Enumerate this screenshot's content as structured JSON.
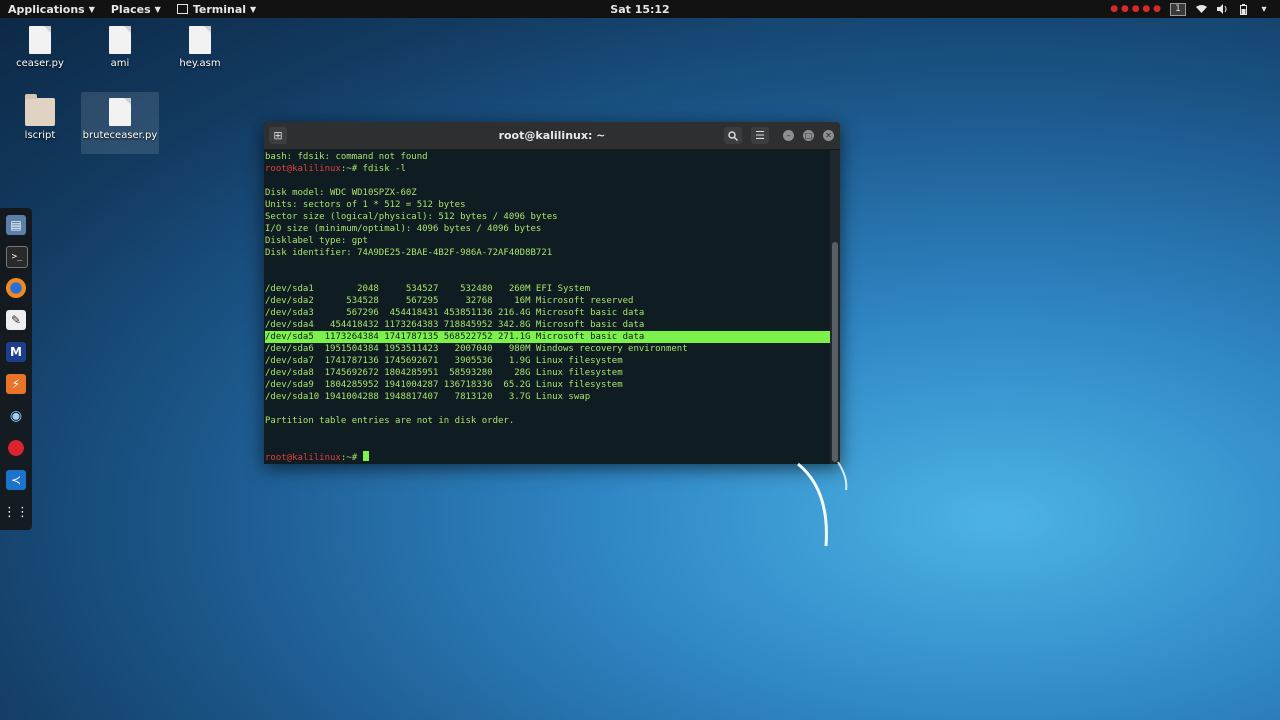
{
  "topbar": {
    "applications": "Applications",
    "places": "Places",
    "terminal": "Terminal",
    "clock": "Sat 15:12",
    "recording": "recording",
    "workspace": "1"
  },
  "desktop": {
    "icons": [
      {
        "label": "ceaser.py"
      },
      {
        "label": "ami"
      },
      {
        "label": "hey.asm"
      },
      {
        "label": "lscript"
      },
      {
        "label": "bruteceaser.py"
      }
    ]
  },
  "dock": {
    "items": [
      "files-icon",
      "terminal-icon",
      "firefox-icon",
      "text-editor-icon",
      "metasploit-icon",
      "burpsuite-icon",
      "eye-icon",
      "cherrytree-icon",
      "vscode-icon",
      "show-apps-icon"
    ]
  },
  "terminal": {
    "title": "root@kalilinux: ~",
    "prompt": "root@kalilinux",
    "prompt_path": ":~# ",
    "lines": {
      "l1": "bash: fdsik: command not found",
      "l2cmd": "fdisk -l",
      "l4": "Disk model: WDC WD10SPZX-60Z",
      "l5": "Units: sectors of 1 * 512 = 512 bytes",
      "l6": "Sector size (logical/physical): 512 bytes / 4096 bytes",
      "l7": "I/O size (minimum/optimal): 4096 bytes / 4096 bytes",
      "l8": "Disklabel type: gpt",
      "l9": "Disk identifier: 74A9DE25-2BAE-4B2F-986A-72AF40D8B721",
      "p1": "/dev/sda1        2048     534527    532480   260M EFI System",
      "p2": "/dev/sda2      534528     567295     32768    16M Microsoft reserved",
      "p3": "/dev/sda3      567296  454418431 453851136 216.4G Microsoft basic data",
      "p4": "/dev/sda4   454418432 1173264383 718845952 342.8G Microsoft basic data",
      "p5": "/dev/sda5  1173264384 1741787135 568522752 271.1G Microsoft basic data",
      "p6": "/dev/sda6  1951504384 1953511423   2007040   980M Windows recovery environment",
      "p7": "/dev/sda7  1741787136 1745692671   3905536   1.9G Linux filesystem",
      "p8": "/dev/sda8  1745692672 1804285951  58593280    28G Linux filesystem",
      "p9": "/dev/sda9  1804285952 1941004287 136718336  65.2G Linux filesystem",
      "p10": "/dev/sda10 1941004288 1948817407   7813120   3.7G Linux swap",
      "note": "Partition table entries are not in disk order."
    }
  },
  "colors": {
    "prompt": "#e0403f",
    "output": "#a8e36b",
    "highlight": "#7cf04b"
  }
}
